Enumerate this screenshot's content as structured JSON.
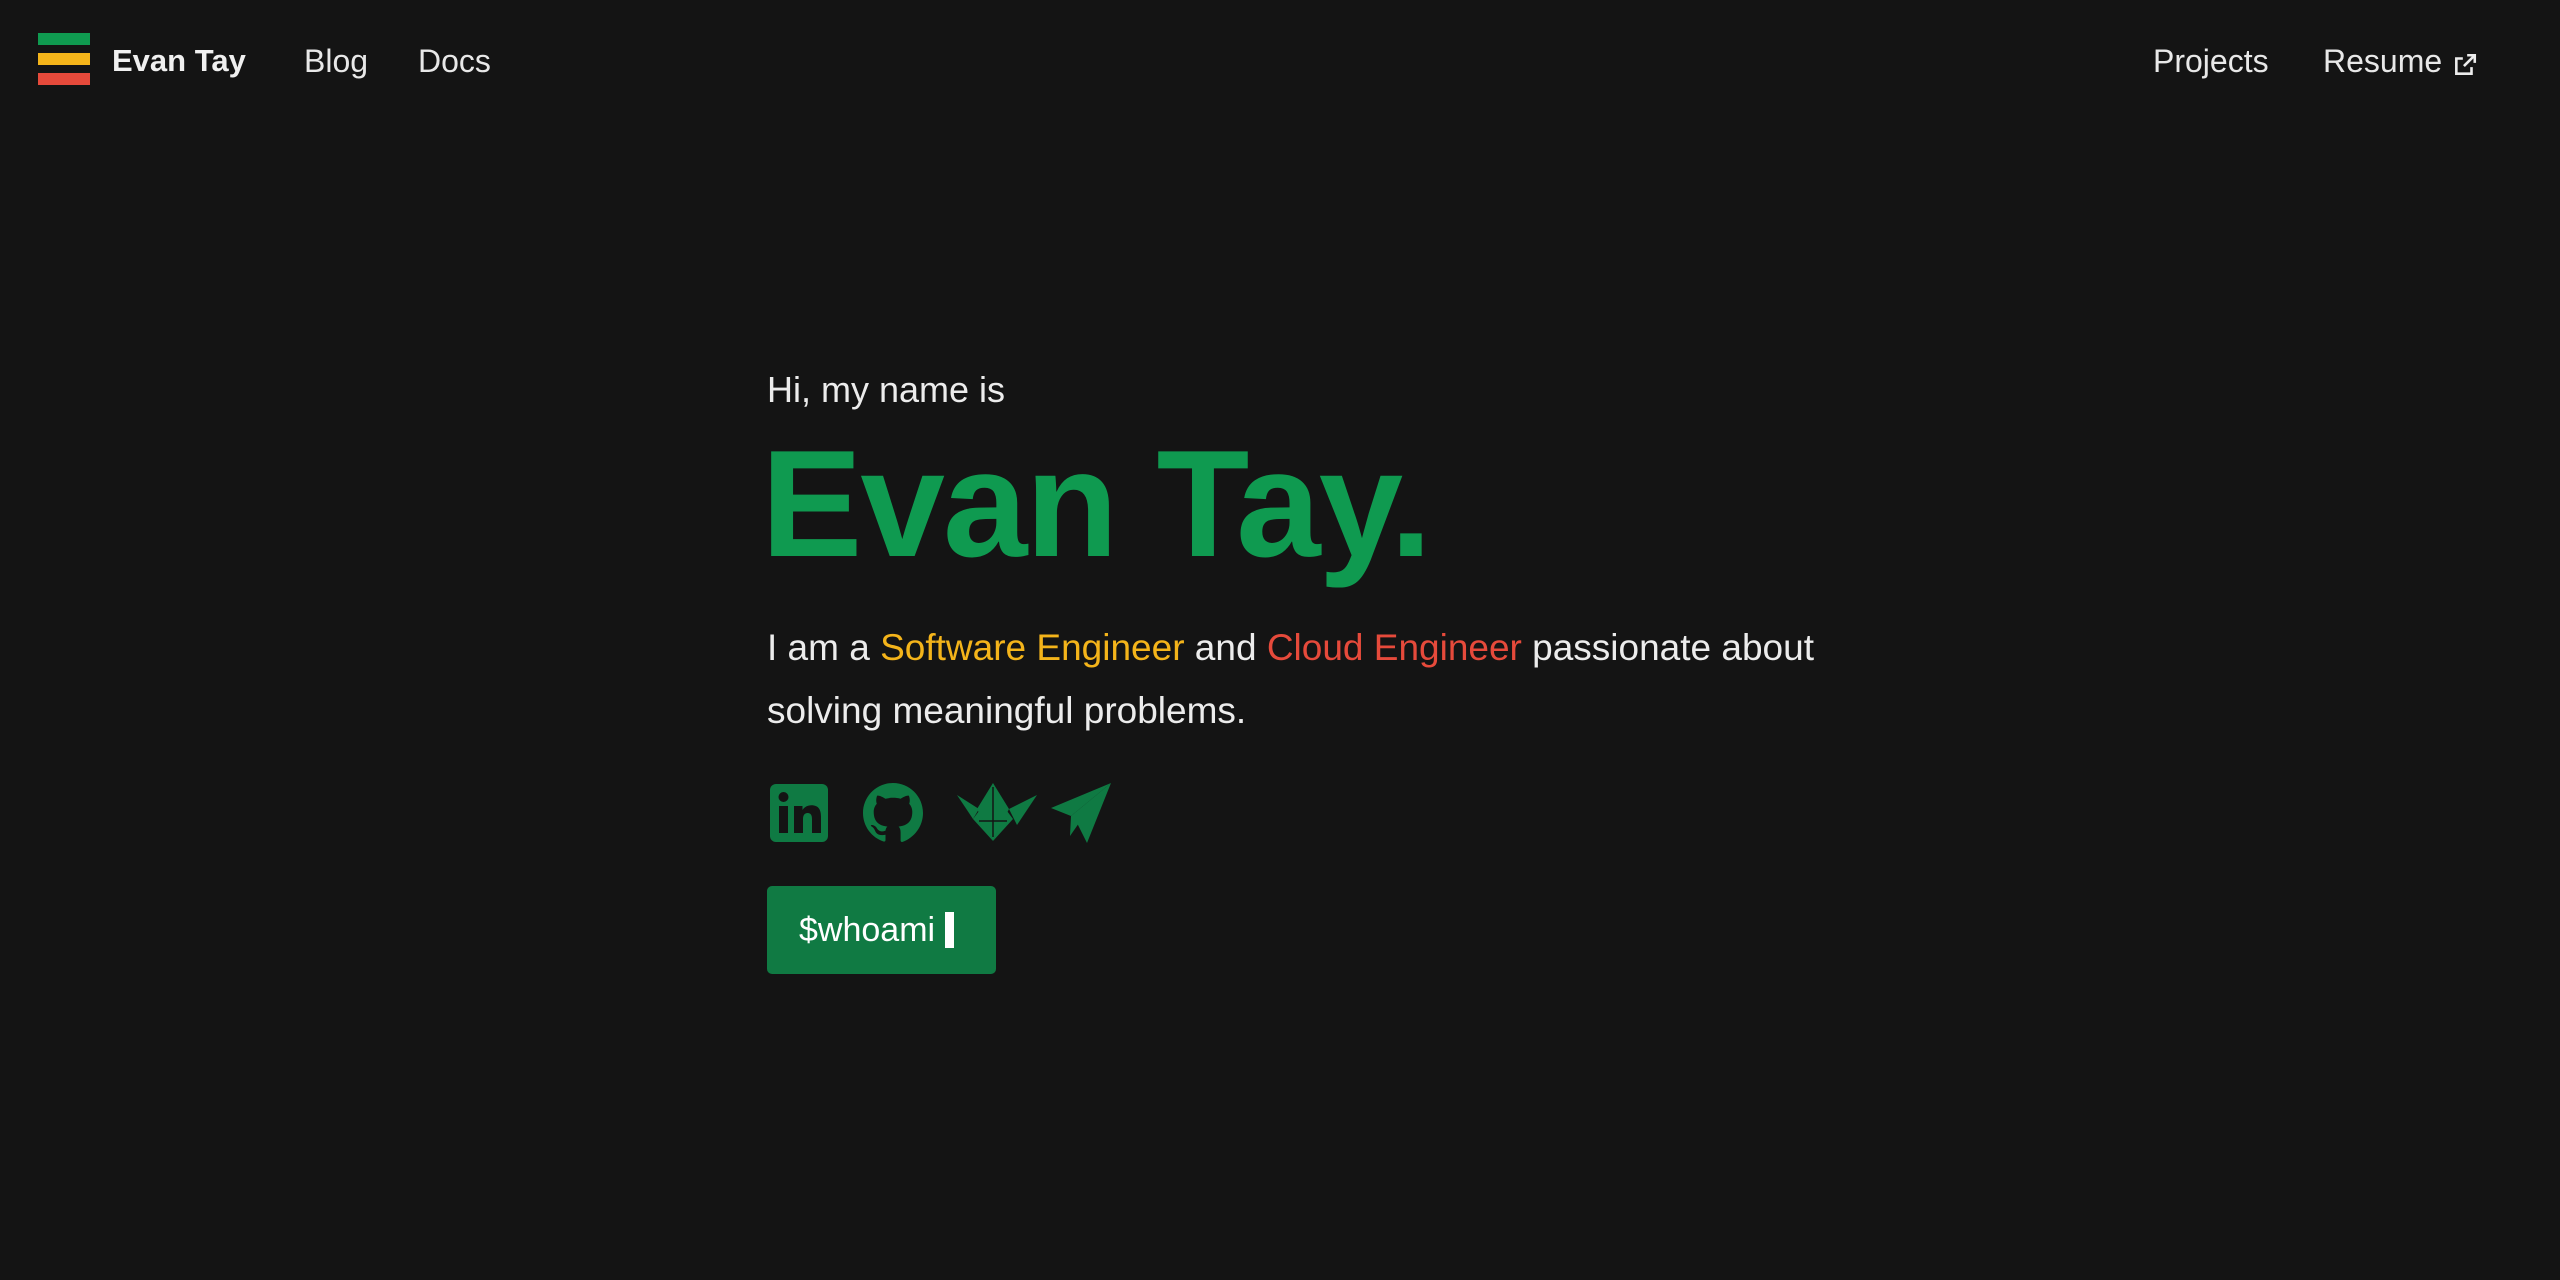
{
  "nav": {
    "brand": "Evan Tay",
    "links": [
      {
        "label": "Blog"
      },
      {
        "label": "Docs"
      },
      {
        "label": "Projects"
      },
      {
        "label": "Resume"
      }
    ]
  },
  "hero": {
    "greeting": "Hi, my name is",
    "name": "Evan Tay.",
    "tagline": {
      "part1": "I am a ",
      "role1": "Software Engineer",
      "part2": " and ",
      "role2": "Cloud Engineer",
      "part3": " passionate about solving meaningful problems."
    },
    "socials": [
      {
        "icon": "linkedin-icon"
      },
      {
        "icon": "github-icon"
      },
      {
        "icon": "crane-icon"
      },
      {
        "icon": "telegram-icon"
      }
    ],
    "cta_label": "$whoami"
  },
  "colors": {
    "background": "#141414",
    "green": "#0f9a50",
    "button_green": "#107a43",
    "yellow": "#f4b41a",
    "red": "#e64a3b"
  }
}
